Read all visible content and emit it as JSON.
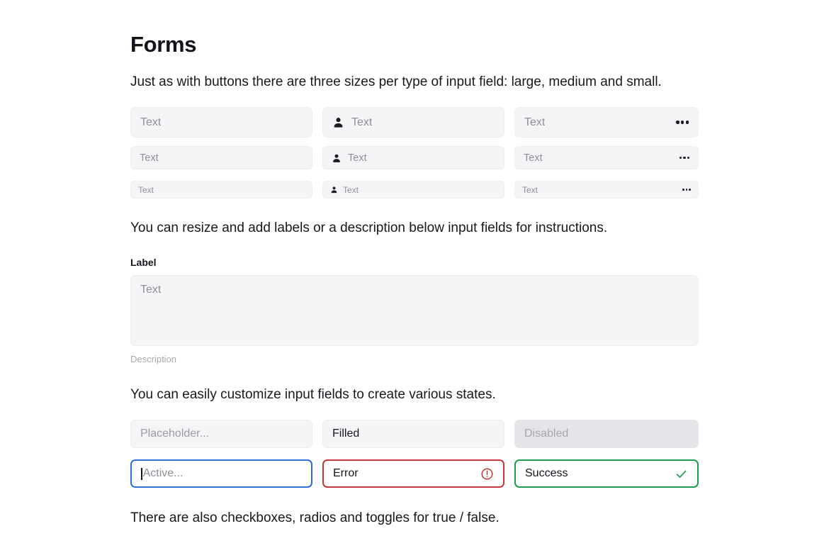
{
  "page": {
    "title": "Forms",
    "intro": "Just as with buttons there are three sizes per type of input field: large, medium and small.",
    "resize_text": "You can resize and add labels or a description below input fields for instructions.",
    "states_text": "You can easily customize input fields to create various states.",
    "footer_text": "There are also checkboxes, radios and toggles for true / false."
  },
  "colors": {
    "field_bg": "#f4f5f7",
    "field_border": "#eceef1",
    "placeholder": "#8e9096",
    "text": "#15161c",
    "active_blue": "#2c6ed5",
    "error_red": "#c6353b",
    "success_green": "#1f9950",
    "disabled_bg": "#e3e5e8"
  },
  "sizes_section": {
    "rows": [
      {
        "size": "large",
        "plain": {
          "placeholder": "Text"
        },
        "with_icon": {
          "placeholder": "Text",
          "icon": "person-icon"
        },
        "with_trailing": {
          "placeholder": "Text",
          "icon": "ellipsis-icon"
        }
      },
      {
        "size": "medium",
        "plain": {
          "placeholder": "Text"
        },
        "with_icon": {
          "placeholder": "Text",
          "icon": "person-icon"
        },
        "with_trailing": {
          "placeholder": "Text",
          "icon": "ellipsis-icon"
        }
      },
      {
        "size": "small",
        "plain": {
          "placeholder": "Text"
        },
        "with_icon": {
          "placeholder": "Text",
          "icon": "person-icon"
        },
        "with_trailing": {
          "placeholder": "Text",
          "icon": "ellipsis-icon"
        }
      }
    ]
  },
  "textarea_section": {
    "label": "Label",
    "placeholder": "Text",
    "description": "Description"
  },
  "states_section": {
    "placeholder_field": {
      "label": "Placeholder...",
      "state": "placeholder"
    },
    "filled_field": {
      "label": "Filled",
      "state": "filled"
    },
    "disabled_field": {
      "label": "Disabled",
      "state": "disabled"
    },
    "active_field": {
      "label": "Active...",
      "state": "active"
    },
    "error_field": {
      "label": "Error",
      "state": "error",
      "icon": "error-circle-icon"
    },
    "success_field": {
      "label": "Success",
      "state": "success",
      "icon": "check-icon"
    }
  }
}
